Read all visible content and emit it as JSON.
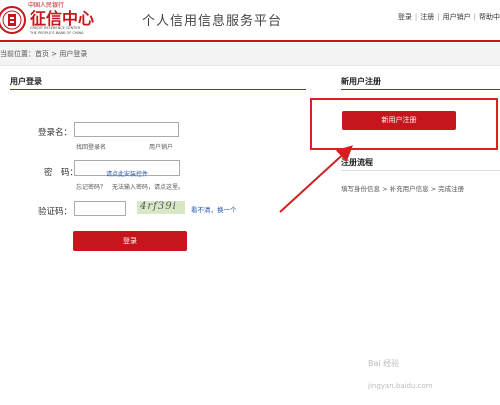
{
  "header": {
    "logo": {
      "top_text": "中国人民银行",
      "main_text": "征信中心",
      "en_line1": "CREDIT REFERENCE CENTER",
      "en_line2": "THE PEOPLE'S BANK OF CHINA"
    },
    "site_title": "个人信用信息服务平台",
    "nav": {
      "login": "登录",
      "register": "注册",
      "cancel": "用户销户",
      "help": "帮助中"
    }
  },
  "breadcrumb": {
    "text": "当前位置：首页 > 用户登录"
  },
  "login": {
    "section_title": "用户登录",
    "username_label": "登录名：",
    "find_username": "找回登录名",
    "cancel_user": "用户销户",
    "password_label": "密　码：",
    "install_control": "请点此安装控件",
    "forgot_password": "忘记密码？",
    "cannot_input": "无法输入密码，请点这里。",
    "captcha_label": "验证码：",
    "captcha_text": "4rf39i",
    "captcha_refresh": "看不清，换一个",
    "submit": "登录"
  },
  "register": {
    "section_title": "新用户注册",
    "button": "新用户注册",
    "flow_title": "注册流程",
    "flow_steps": "填写身份信息 > 补充用户信息 > 完成注册"
  },
  "watermark": {
    "text": "Bai 经验",
    "url": "jingyan.baidu.com"
  },
  "colors": {
    "brand_red": "#c4161c",
    "highlight": "#e02020"
  }
}
